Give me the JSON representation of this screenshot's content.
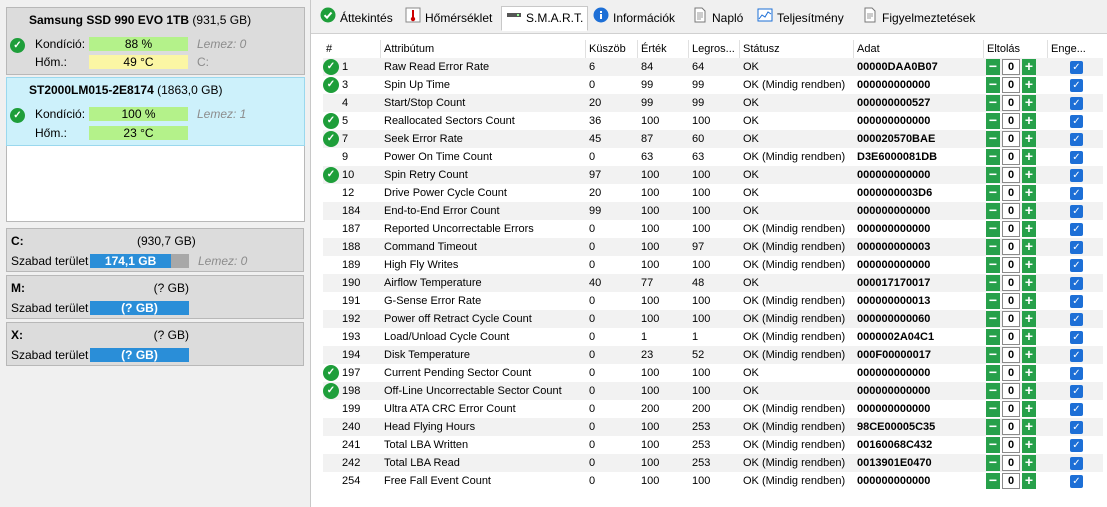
{
  "disks": [
    {
      "name": "Samsung SSD 990 EVO 1TB",
      "size": "(931,5 GB)",
      "condition_label": "Kondíció:",
      "condition_value": "88 %",
      "condition_extra": "Lemez: 0",
      "temp_label": "Hőm.:",
      "temp_value": "49 °C",
      "temp_extra": "C:"
    },
    {
      "name": "ST2000LM015-2E8174",
      "size": "(1863,0 GB)",
      "condition_label": "Kondíció:",
      "condition_value": "100 %",
      "condition_extra": "Lemez: 1",
      "temp_label": "Hőm.:",
      "temp_value": "23 °C"
    }
  ],
  "volumes": [
    {
      "name": "C:",
      "size": "(930,7 GB)",
      "free_label": "Szabad terület",
      "free_value": "174,1 GB",
      "free_fraction": 0.82,
      "extra": "Lemez: 0"
    },
    {
      "name": "M:",
      "size": "(? GB)",
      "free_label": "Szabad terület",
      "free_value": "(? GB)",
      "free_fraction": 1.0
    },
    {
      "name": "X:",
      "size": "(? GB)",
      "free_label": "Szabad terület",
      "free_value": "(? GB)",
      "free_fraction": 1.0
    }
  ],
  "tabs": [
    {
      "label": "Áttekintés",
      "icon": "check-circle-icon"
    },
    {
      "label": "Hőmérséklet",
      "icon": "thermometer-icon"
    },
    {
      "label": "S.M.A.R.T.",
      "icon": "drive-icon",
      "active": true
    },
    {
      "label": "Információk",
      "icon": "info-icon"
    },
    {
      "label": "Napló",
      "icon": "document-icon"
    },
    {
      "label": "Teljesítmény",
      "icon": "chart-icon"
    },
    {
      "label": "Figyelmeztetések",
      "icon": "warning-doc-icon"
    }
  ],
  "table": {
    "headers": [
      "#",
      "Attribútum",
      "Küszöb",
      "Érték",
      "Legros...",
      "Státusz",
      "Adat",
      "Eltolás",
      "Enge..."
    ],
    "rows": [
      {
        "ok": true,
        "id": "1",
        "attr": "Raw Read Error Rate",
        "thr": "6",
        "val": "84",
        "worst": "64",
        "status": "OK",
        "data": "00000DAA0B07",
        "offset": "0"
      },
      {
        "ok": true,
        "id": "3",
        "attr": "Spin Up Time",
        "thr": "0",
        "val": "99",
        "worst": "99",
        "status": "OK (Mindig rendben)",
        "data": "000000000000",
        "offset": "0"
      },
      {
        "ok": false,
        "id": "4",
        "attr": "Start/Stop Count",
        "thr": "20",
        "val": "99",
        "worst": "99",
        "status": "OK",
        "data": "000000000527",
        "offset": "0"
      },
      {
        "ok": true,
        "id": "5",
        "attr": "Reallocated Sectors Count",
        "thr": "36",
        "val": "100",
        "worst": "100",
        "status": "OK",
        "data": "000000000000",
        "offset": "0"
      },
      {
        "ok": true,
        "id": "7",
        "attr": "Seek Error Rate",
        "thr": "45",
        "val": "87",
        "worst": "60",
        "status": "OK",
        "data": "000020570BAE",
        "offset": "0"
      },
      {
        "ok": false,
        "id": "9",
        "attr": "Power On Time Count",
        "thr": "0",
        "val": "63",
        "worst": "63",
        "status": "OK (Mindig rendben)",
        "data": "D3E6000081DB",
        "offset": "0"
      },
      {
        "ok": true,
        "id": "10",
        "attr": "Spin Retry Count",
        "thr": "97",
        "val": "100",
        "worst": "100",
        "status": "OK",
        "data": "000000000000",
        "offset": "0"
      },
      {
        "ok": false,
        "id": "12",
        "attr": "Drive Power Cycle Count",
        "thr": "20",
        "val": "100",
        "worst": "100",
        "status": "OK",
        "data": "0000000003D6",
        "offset": "0"
      },
      {
        "ok": false,
        "id": "184",
        "attr": "End-to-End Error Count",
        "thr": "99",
        "val": "100",
        "worst": "100",
        "status": "OK",
        "data": "000000000000",
        "offset": "0"
      },
      {
        "ok": false,
        "id": "187",
        "attr": "Reported Uncorrectable Errors",
        "thr": "0",
        "val": "100",
        "worst": "100",
        "status": "OK (Mindig rendben)",
        "data": "000000000000",
        "offset": "0"
      },
      {
        "ok": false,
        "id": "188",
        "attr": "Command Timeout",
        "thr": "0",
        "val": "100",
        "worst": "97",
        "status": "OK (Mindig rendben)",
        "data": "000000000003",
        "offset": "0"
      },
      {
        "ok": false,
        "id": "189",
        "attr": "High Fly Writes",
        "thr": "0",
        "val": "100",
        "worst": "100",
        "status": "OK (Mindig rendben)",
        "data": "000000000000",
        "offset": "0"
      },
      {
        "ok": false,
        "id": "190",
        "attr": "Airflow Temperature",
        "thr": "40",
        "val": "77",
        "worst": "48",
        "status": "OK",
        "data": "000017170017",
        "offset": "0"
      },
      {
        "ok": false,
        "id": "191",
        "attr": "G-Sense Error Rate",
        "thr": "0",
        "val": "100",
        "worst": "100",
        "status": "OK (Mindig rendben)",
        "data": "000000000013",
        "offset": "0"
      },
      {
        "ok": false,
        "id": "192",
        "attr": "Power off Retract Cycle Count",
        "thr": "0",
        "val": "100",
        "worst": "100",
        "status": "OK (Mindig rendben)",
        "data": "000000000060",
        "offset": "0"
      },
      {
        "ok": false,
        "id": "193",
        "attr": "Load/Unload Cycle Count",
        "thr": "0",
        "val": "1",
        "worst": "1",
        "status": "OK (Mindig rendben)",
        "data": "0000002A04C1",
        "offset": "0"
      },
      {
        "ok": false,
        "id": "194",
        "attr": "Disk Temperature",
        "thr": "0",
        "val": "23",
        "worst": "52",
        "status": "OK (Mindig rendben)",
        "data": "000F00000017",
        "offset": "0"
      },
      {
        "ok": true,
        "id": "197",
        "attr": "Current Pending Sector Count",
        "thr": "0",
        "val": "100",
        "worst": "100",
        "status": "OK",
        "data": "000000000000",
        "offset": "0"
      },
      {
        "ok": true,
        "id": "198",
        "attr": "Off-Line Uncorrectable Sector Count",
        "thr": "0",
        "val": "100",
        "worst": "100",
        "status": "OK",
        "data": "000000000000",
        "offset": "0"
      },
      {
        "ok": false,
        "id": "199",
        "attr": "Ultra ATA CRC Error Count",
        "thr": "0",
        "val": "200",
        "worst": "200",
        "status": "OK (Mindig rendben)",
        "data": "000000000000",
        "offset": "0"
      },
      {
        "ok": false,
        "id": "240",
        "attr": "Head Flying Hours",
        "thr": "0",
        "val": "100",
        "worst": "253",
        "status": "OK (Mindig rendben)",
        "data": "98CE00005C35",
        "offset": "0"
      },
      {
        "ok": false,
        "id": "241",
        "attr": "Total LBA Written",
        "thr": "0",
        "val": "100",
        "worst": "253",
        "status": "OK (Mindig rendben)",
        "data": "00160068C432",
        "offset": "0"
      },
      {
        "ok": false,
        "id": "242",
        "attr": "Total LBA Read",
        "thr": "0",
        "val": "100",
        "worst": "253",
        "status": "OK (Mindig rendben)",
        "data": "0013901E0470",
        "offset": "0"
      },
      {
        "ok": false,
        "id": "254",
        "attr": "Free Fall Event Count",
        "thr": "0",
        "val": "100",
        "worst": "100",
        "status": "OK (Mindig rendben)",
        "data": "000000000000",
        "offset": "0"
      }
    ]
  }
}
